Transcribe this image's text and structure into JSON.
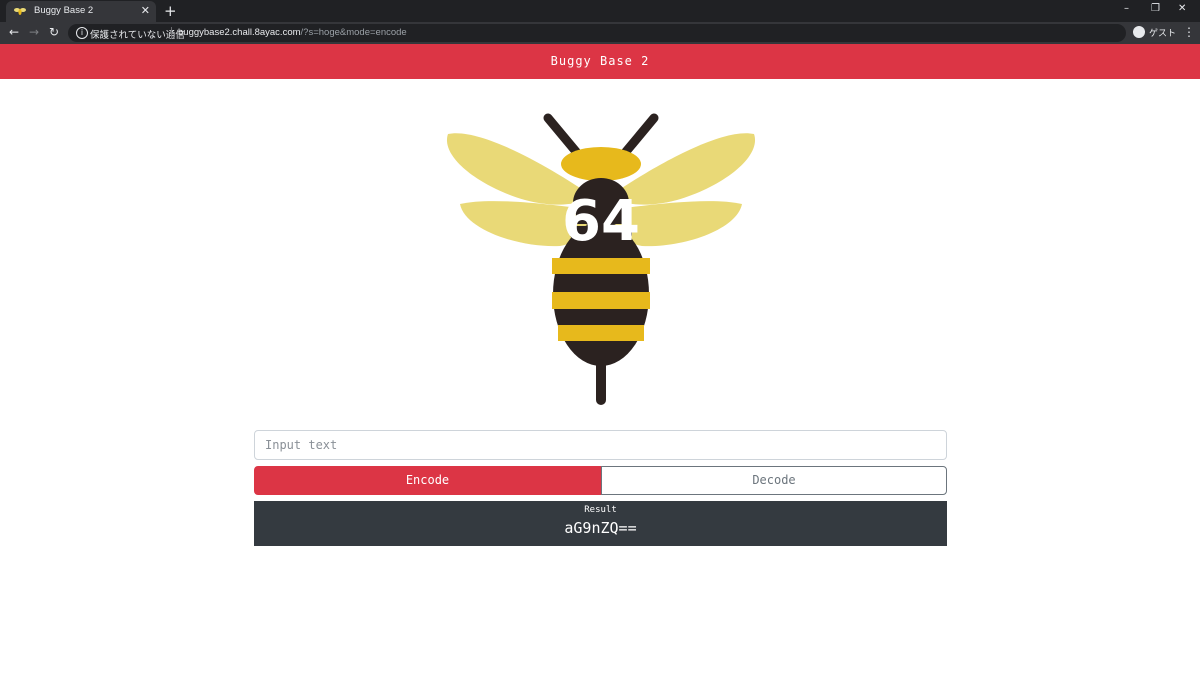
{
  "browser": {
    "tab_title": "Buggy Base 2",
    "tab_close": "✕",
    "new_tab": "+",
    "security_label": "保護されていない通信",
    "url_host": "buggybase2.chall.8ayac.com",
    "url_path": "/?s=hoge&mode=encode",
    "profile_label": "ゲスト",
    "window_controls": [
      "–",
      "❐",
      "✕"
    ],
    "nav": {
      "back": "←",
      "forward": "→",
      "reload": "↻"
    },
    "menu": "⋮"
  },
  "header": {
    "title": "Buggy Base 2"
  },
  "logo": {
    "text": "64",
    "colors": {
      "yellow": "#e7b91c",
      "pale_yellow": "#e9d977",
      "dark": "#2b2220"
    }
  },
  "form": {
    "input": {
      "placeholder": "Input text",
      "value": ""
    },
    "encode_label": "Encode",
    "decode_label": "Decode"
  },
  "result": {
    "label": "Result",
    "value": "aG9nZQ=="
  },
  "colors": {
    "accent": "#dc3545",
    "result_bg": "#343a40",
    "chrome_dark": "#202124",
    "chrome_toolbar": "#35363a"
  }
}
